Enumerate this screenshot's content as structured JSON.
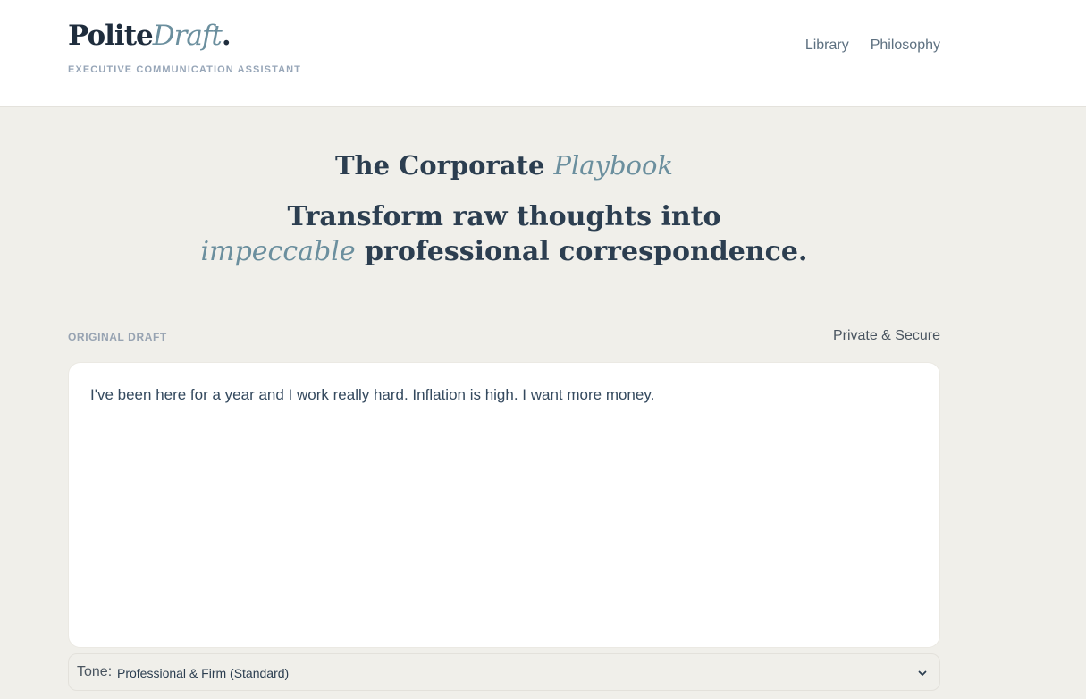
{
  "brand": {
    "name_main": "Polite",
    "name_accent": "Draft",
    "name_dot": ".",
    "tagline": "EXECUTIVE COMMUNICATION ASSISTANT"
  },
  "nav": {
    "items": [
      {
        "label": "Library"
      },
      {
        "label": "Philosophy"
      }
    ]
  },
  "hero": {
    "title_main": "The Corporate ",
    "title_accent": "Playbook",
    "subtitle_line1": "Transform raw thoughts into",
    "subtitle_accent": "impeccable",
    "subtitle_rest": " professional correspondence."
  },
  "draft": {
    "label": "ORIGINAL DRAFT",
    "privacy": "Private & Secure",
    "text": "I've been here for a year and I work really hard. Inflation is high. I want more money."
  },
  "tone": {
    "label": "Tone:",
    "value": "Professional & Firm (Standard)"
  },
  "icons": {
    "tone_dropdown": "chevron-down-icon"
  },
  "colors": {
    "background": "#f0efea",
    "header_bg": "#ffffff",
    "accent": "#6b8f9e",
    "heading": "#2c3e50"
  }
}
